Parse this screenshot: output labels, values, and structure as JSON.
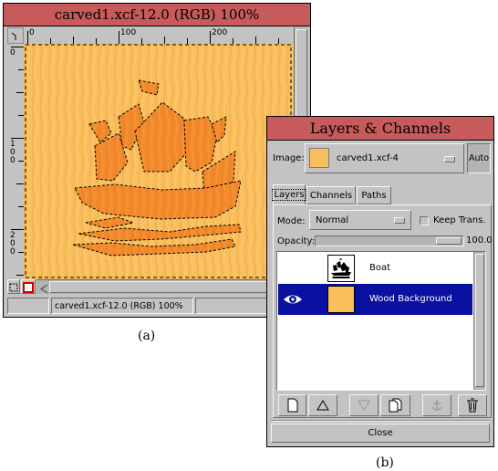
{
  "image_window": {
    "title": "carved1.xcf-12.0 (RGB) 100%",
    "ruler_top": [
      "0",
      "100",
      "200"
    ],
    "ruler_left": [
      "0",
      "100",
      "200"
    ],
    "status_text": "carved1.xcf-12.0 (RGB) 100%"
  },
  "layers_dialog": {
    "title": "Layers & Channels",
    "image_label": "Image:",
    "image_value": "carved1.xcf-4",
    "auto_button": "Auto",
    "tabs": [
      "Layers",
      "Channels",
      "Paths"
    ],
    "mode_label": "Mode:",
    "mode_value": "Normal",
    "keep_trans_label": "Keep Trans.",
    "opacity_label": "Opacity:",
    "opacity_value": "100.0",
    "layers": [
      {
        "name": "Boat",
        "visible": false,
        "selected": false
      },
      {
        "name": "Wood Background",
        "visible": true,
        "selected": true
      }
    ],
    "action_icons": [
      "new-layer-icon",
      "raise-layer-icon",
      "lower-layer-icon",
      "duplicate-layer-icon",
      "anchor-icon",
      "delete-icon"
    ],
    "close_button": "Close"
  },
  "captions": {
    "a": "(a)",
    "b": "(b)"
  },
  "colors": {
    "titlebar": "#c75a5a",
    "window_bg": "#c3c3c3",
    "selection": "#0a10a0",
    "wood_base": "#f9bf5c",
    "wood_dark": "#f28a2c"
  }
}
